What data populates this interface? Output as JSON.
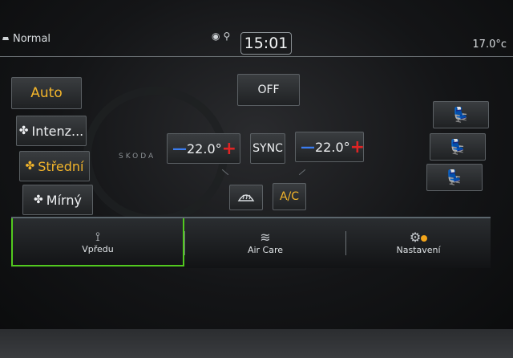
{
  "status": {
    "drive_mode": "Normal",
    "time": "15:01",
    "outside_temp": "17.0°c"
  },
  "climate": {
    "auto_label": "Auto",
    "off_label": "OFF",
    "sync_label": "SYNC",
    "ac_label": "A/C",
    "left_temp": "22.0°",
    "right_temp": "22.0°",
    "minus_glyph": "—",
    "plus_glyph": "+",
    "fan_modes": [
      {
        "label": "Intenz...",
        "icon": "fan-icon",
        "active": false
      },
      {
        "label": "Střední",
        "icon": "fan-icon",
        "active": true
      },
      {
        "label": "Mírný",
        "icon": "fan-icon",
        "active": false
      }
    ],
    "brand_mark": "SKODA"
  },
  "tabs": [
    {
      "label": "Vpředu",
      "icon": "seat-icon",
      "active": true
    },
    {
      "label": "Air Care",
      "icon": "air-waves-icon",
      "active": false
    },
    {
      "label": "Nastavení",
      "icon": "gear-icon",
      "active": false
    }
  ],
  "colors": {
    "accent_yellow": "#f3b52b",
    "active_tab_green": "#52c91f",
    "minus_blue": "#3b7df0",
    "plus_red": "#e02424"
  }
}
